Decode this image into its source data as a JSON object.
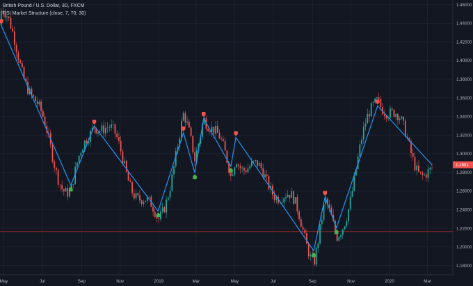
{
  "legend": {
    "symbol_line": "British Pound / U.S. Dollar, 3D, FXCM",
    "indicator_line": "RSI Market Structure (close, 7, 70, 30)"
  },
  "colors": {
    "background": "#131722",
    "zigzag": "#2196f3",
    "bull_candle": "#26a69a",
    "bear_candle": "#ef5350",
    "high_marker": "#ef5350",
    "low_marker": "#4caf50",
    "price_badge": "#ef5350",
    "horizontal_level": "#8b2a2a"
  },
  "price_badge": {
    "text": "1.2881"
  },
  "horizontal_level": {
    "value": 1.2165
  },
  "chart_data": {
    "type": "line",
    "title": "British Pound / U.S. Dollar, 3D, FXCM",
    "y_axis_side": "right",
    "ylim": [
      1.17,
      1.465
    ],
    "y_ticks": [
      1.18,
      1.2,
      1.22,
      1.24,
      1.26,
      1.28,
      1.3,
      1.32,
      1.34,
      1.36,
      1.38,
      1.4,
      1.42,
      1.44,
      1.46
    ],
    "y_tick_labels": [
      "1.18000",
      "1.20000",
      "1.22000",
      "1.24000",
      "1.26000",
      "1.28000",
      "1.30000",
      "1.32000",
      "1.34000",
      "1.36000",
      "1.38000",
      "1.40000",
      "1.42000",
      "1.44000",
      "1.46000"
    ],
    "xlim": [
      "2018-04-25",
      "2020-04-10"
    ],
    "x_ticks": [
      {
        "date": "2018-05-01",
        "label": "May"
      },
      {
        "date": "2018-07-01",
        "label": "Jul"
      },
      {
        "date": "2018-09-01",
        "label": "Sep"
      },
      {
        "date": "2018-11-01",
        "label": "Nov"
      },
      {
        "date": "2019-01-01",
        "label": "2019"
      },
      {
        "date": "2019-03-01",
        "label": "Mar"
      },
      {
        "date": "2019-05-01",
        "label": "May"
      },
      {
        "date": "2019-07-01",
        "label": "Jul"
      },
      {
        "date": "2019-09-01",
        "label": "Sep"
      },
      {
        "date": "2019-11-01",
        "label": "Nov"
      },
      {
        "date": "2020-01-01",
        "label": "2020"
      },
      {
        "date": "2020-03-01",
        "label": "Mar"
      }
    ],
    "grid": true,
    "legend_position": "top-left",
    "series": [
      {
        "name": "RSI Market Structure",
        "style": "zigzag",
        "points": [
          {
            "x": "2018-04-27",
            "y": 1.4377,
            "pivot": "high"
          },
          {
            "x": "2018-08-15",
            "y": 1.2662,
            "pivot": "low"
          },
          {
            "x": "2018-09-21",
            "y": 1.3298,
            "pivot": "high"
          },
          {
            "x": "2018-12-31",
            "y": 1.2385,
            "pivot": "low"
          },
          {
            "x": "2019-02-09",
            "y": 1.3225,
            "pivot": "high"
          },
          {
            "x": "2019-02-27",
            "y": 1.2795,
            "pivot": "low"
          },
          {
            "x": "2019-03-13",
            "y": 1.338,
            "pivot": "high"
          },
          {
            "x": "2019-04-25",
            "y": 1.2865,
            "pivot": "low"
          },
          {
            "x": "2019-05-03",
            "y": 1.3175,
            "pivot": "high"
          },
          {
            "x": "2019-09-03",
            "y": 1.1958,
            "pivot": "low"
          },
          {
            "x": "2019-09-21",
            "y": 1.2535,
            "pivot": "high"
          },
          {
            "x": "2019-10-09",
            "y": 1.2205,
            "pivot": "low"
          },
          {
            "x": "2019-12-13",
            "y": 1.3515,
            "pivot": "high"
          },
          {
            "x": "2020-03-08",
            "y": 1.2881,
            "pivot": "none"
          }
        ]
      }
    ]
  }
}
